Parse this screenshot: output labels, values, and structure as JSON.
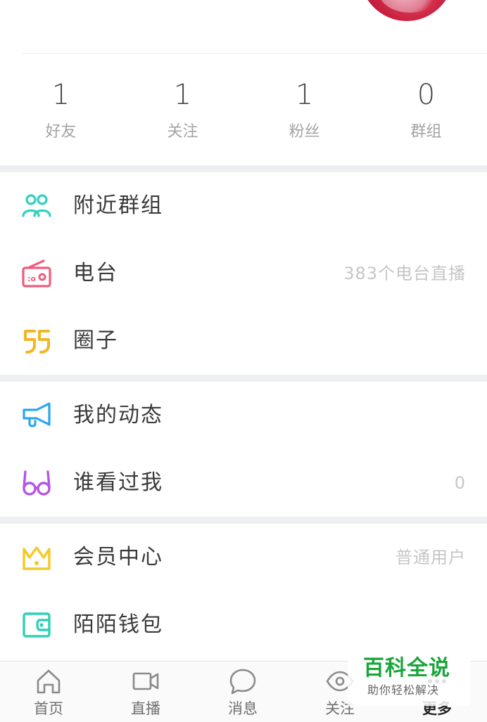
{
  "stats": [
    {
      "count": "1",
      "label": "好友"
    },
    {
      "count": "1",
      "label": "关注"
    },
    {
      "count": "1",
      "label": "粉丝"
    },
    {
      "count": "0",
      "label": "群组"
    }
  ],
  "menu": {
    "nearby_groups": {
      "label": "附近群组",
      "icon": "people-icon",
      "color": "#2fd1c0"
    },
    "radio": {
      "label": "电台",
      "extra": "383个电台直播",
      "icon": "radio-icon",
      "color": "#ef5c7c"
    },
    "circle": {
      "label": "圈子",
      "icon": "quote-icon",
      "color": "#f0b722"
    },
    "my_moments": {
      "label": "我的动态",
      "icon": "megaphone-icon",
      "color": "#29a6ec"
    },
    "visitors": {
      "label": "谁看过我",
      "extra": "0",
      "icon": "glasses-icon",
      "color": "#b554e6"
    },
    "vip_center": {
      "label": "会员中心",
      "extra": "普通用户",
      "icon": "crown-icon",
      "color": "#f5c926"
    },
    "wallet": {
      "label": "陌陌钱包",
      "icon": "wallet-icon",
      "color": "#2fd1b4"
    }
  },
  "tabs": [
    {
      "label": "首页",
      "icon": "home-icon"
    },
    {
      "label": "直播",
      "icon": "video-icon"
    },
    {
      "label": "消息",
      "icon": "chat-bubble-icon"
    },
    {
      "label": "关注",
      "icon": "eye-icon"
    },
    {
      "label": "更多",
      "icon": "more-icon"
    }
  ],
  "watermark": {
    "title": "百科全说",
    "subtitle": "助你轻松解决"
  }
}
